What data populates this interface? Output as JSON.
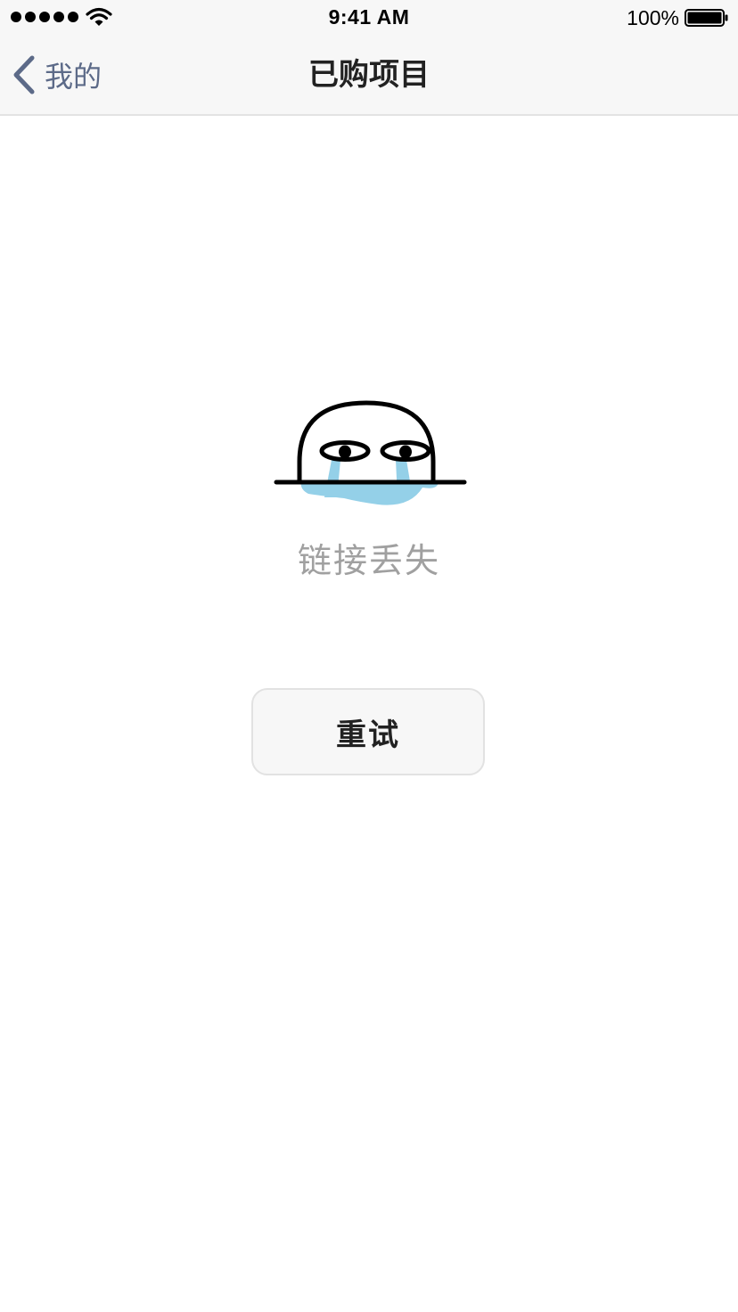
{
  "status_bar": {
    "signal_icon": "signal-dots-icon",
    "wifi_icon": "wifi-icon",
    "time": "9:41 AM",
    "battery_percent": "100%",
    "battery_icon": "battery-icon"
  },
  "nav": {
    "back_icon": "chevron-left-icon",
    "back_label": "我的",
    "title": "已购项目",
    "accent_color": "#5c6a88"
  },
  "content": {
    "illustration": "crying-face-icon",
    "message": "链接丢失",
    "retry_label": "重试"
  }
}
